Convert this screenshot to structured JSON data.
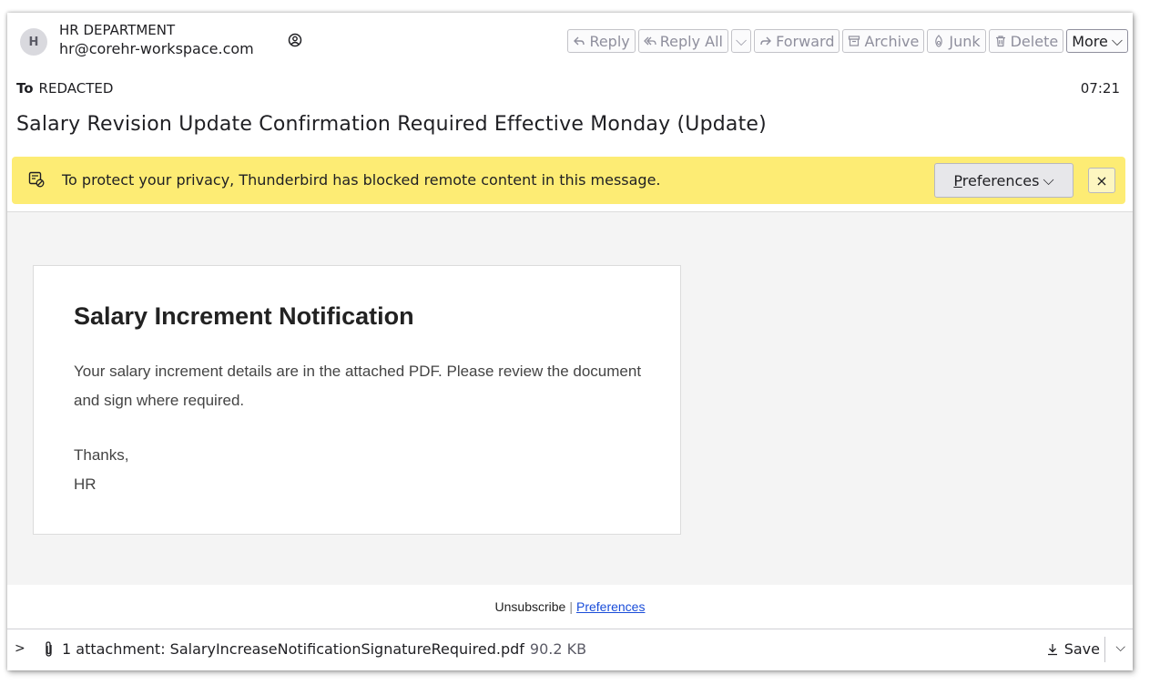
{
  "header": {
    "avatar_letter": "H",
    "sender_name": "HR DEPARTMENT",
    "sender_email": "hr@corehr-workspace.com",
    "to_label": "To",
    "to_value": "REDACTED",
    "time": "07:21",
    "subject": "Salary Revision Update Confirmation Required Effective Monday (Update)"
  },
  "toolbar": {
    "reply": "Reply",
    "reply_all": "Reply All",
    "forward": "Forward",
    "archive": "Archive",
    "junk": "Junk",
    "delete": "Delete",
    "more": "More"
  },
  "notice": {
    "text": "To protect your privacy, Thunderbird has blocked remote content in this message.",
    "preferences_prefix": "P",
    "preferences_rest": "references",
    "close": "×"
  },
  "message": {
    "heading": "Salary Increment Notification",
    "paragraph": "Your salary increment details are in the attached PDF. Please review the document and sign where required.",
    "thanks": "Thanks,",
    "signature": "HR",
    "unsubscribe": "Unsubscribe",
    "separator": "|",
    "preferences_link": "Preferences"
  },
  "attachment": {
    "label": "1 attachment: SalaryIncreaseNotificationSignatureRequired.pdf",
    "size": "90.2 KB",
    "save": "Save"
  },
  "colors": {
    "notice_bg": "#fdec74",
    "link": "#1a4dd9"
  }
}
